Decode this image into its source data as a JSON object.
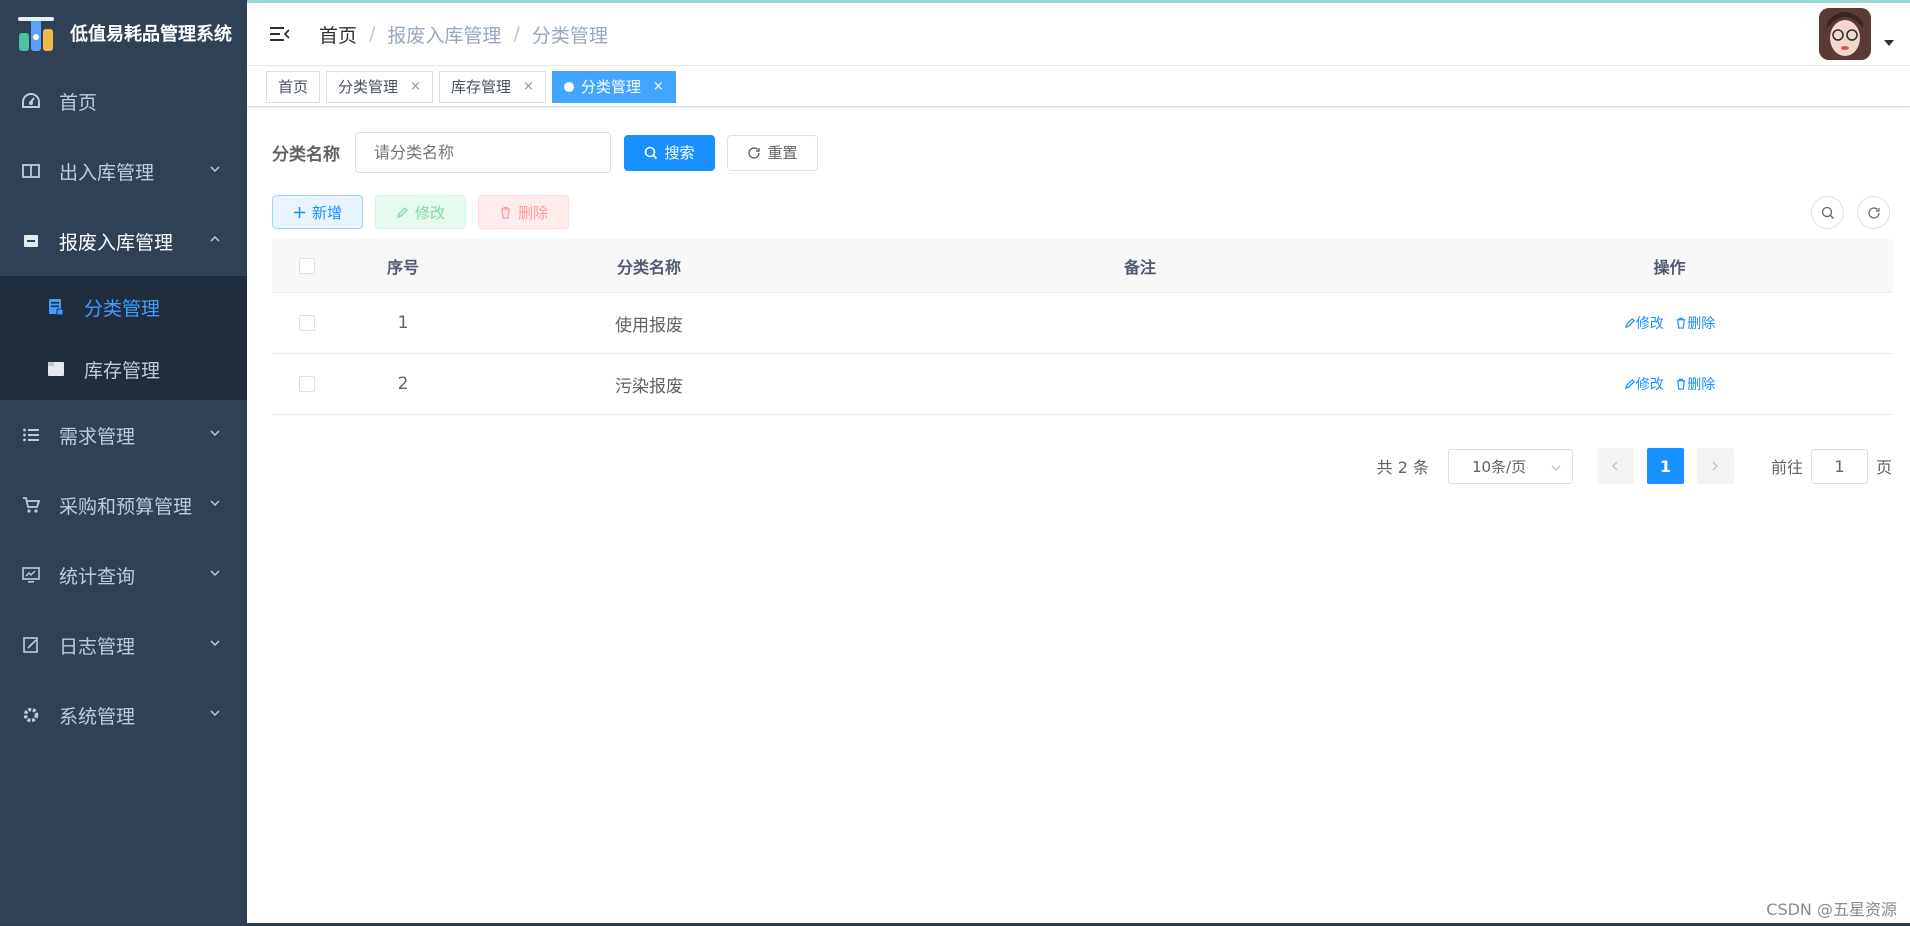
{
  "app": {
    "title": "低值易耗品管理系统"
  },
  "sidebar": {
    "items": [
      {
        "label": "首页",
        "icon": "dashboard-icon"
      },
      {
        "label": "出入库管理",
        "icon": "book-open-icon"
      },
      {
        "label": "报废入库管理",
        "icon": "inbox-icon",
        "expanded": true,
        "children": [
          {
            "label": "分类管理",
            "icon": "document-icon",
            "active": true
          },
          {
            "label": "库存管理",
            "icon": "folder-icon"
          }
        ]
      },
      {
        "label": "需求管理",
        "icon": "list-icon"
      },
      {
        "label": "采购和预算管理",
        "icon": "shopping-cart-icon"
      },
      {
        "label": "统计查询",
        "icon": "monitor-icon"
      },
      {
        "label": "日志管理",
        "icon": "edit-log-icon"
      },
      {
        "label": "系统管理",
        "icon": "gear-icon"
      }
    ]
  },
  "header": {
    "breadcrumb": [
      "首页",
      "报废入库管理",
      "分类管理"
    ]
  },
  "tags": [
    {
      "label": "首页",
      "closable": false,
      "active": false
    },
    {
      "label": "分类管理",
      "closable": true,
      "active": false
    },
    {
      "label": "库存管理",
      "closable": true,
      "active": false
    },
    {
      "label": "分类管理",
      "closable": true,
      "active": true
    }
  ],
  "search": {
    "label": "分类名称",
    "placeholder": "请分类名称",
    "search_label": "搜索",
    "reset_label": "重置"
  },
  "toolbar": {
    "add_label": "新增",
    "edit_label": "修改",
    "delete_label": "删除"
  },
  "table": {
    "columns": [
      "序号",
      "分类名称",
      "备注",
      "操作"
    ],
    "rows": [
      {
        "index": "1",
        "name": "使用报废",
        "note": "",
        "edit": "修改",
        "delete": "删除"
      },
      {
        "index": "2",
        "name": "污染报废",
        "note": "",
        "edit": "修改",
        "delete": "删除"
      }
    ]
  },
  "pagination": {
    "total_text": "共 2 条",
    "page_size": "10条/页",
    "current_page": "1",
    "goto_label": "前往",
    "goto_value": "1",
    "page_suffix": "页"
  },
  "watermark": "CSDN @五星资源",
  "colors": {
    "sidebar_bg": "#304156",
    "submenu_bg": "#1f2d3d",
    "primary": "#1890ff",
    "active_tag": "#42a5ff"
  }
}
